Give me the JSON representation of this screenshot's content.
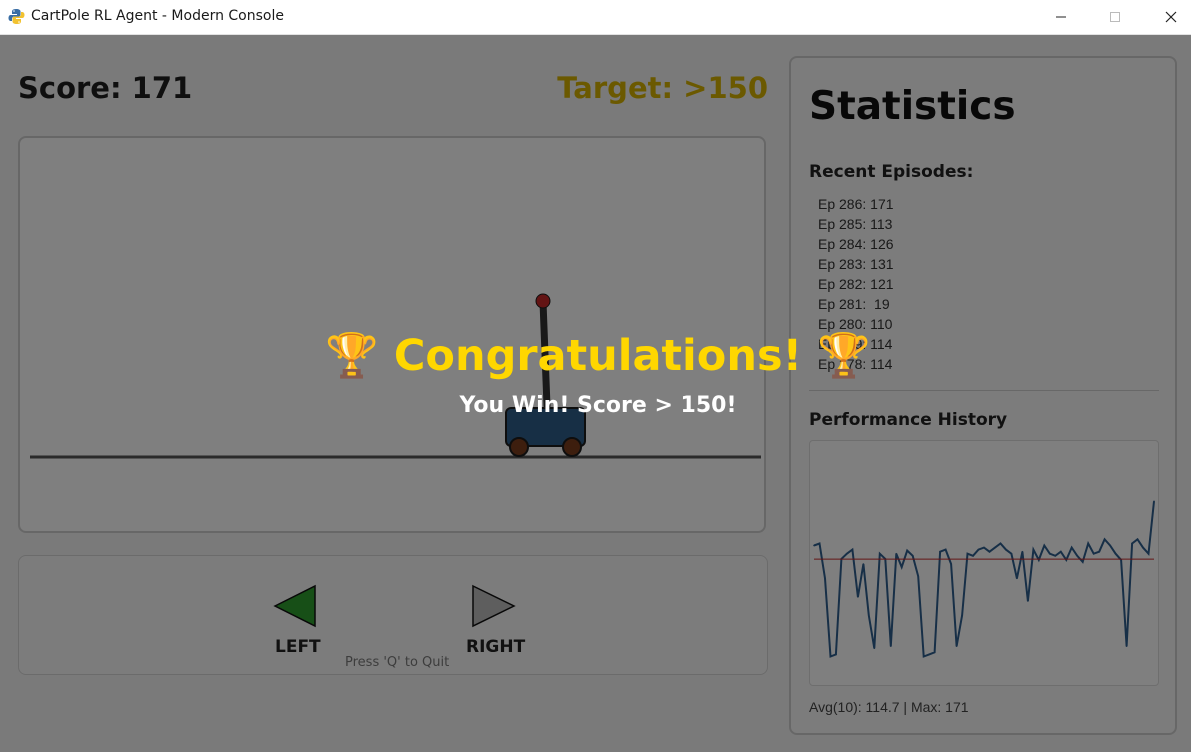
{
  "window": {
    "title": "CartPole RL Agent - Modern Console",
    "icon": "python-snake-icon",
    "controls": [
      "minimize-icon",
      "maximize-icon",
      "close-icon"
    ]
  },
  "header": {
    "score": "Score: 171",
    "target": "Target: >150"
  },
  "game": {
    "cart_color": "#2e5f8a",
    "pole_color": "#333333",
    "pole_tip_color": "#c62828",
    "wheel_color": "#7a3d1c"
  },
  "controls": {
    "left_label": "LEFT",
    "right_label": "RIGHT",
    "quit_hint": "Press 'Q' to Quit",
    "left_color": "#2e9e2e",
    "right_color": "#bdbdbd"
  },
  "stats": {
    "title": "Statistics",
    "recent_title": "Recent Episodes:",
    "episodes": [
      "Ep 286: 171",
      "Ep 285: 113",
      "Ep 284: 126",
      "Ep 283: 131",
      "Ep 282: 121",
      "Ep 281:  19",
      "Ep 280: 110",
      "Ep 279: 114",
      "Ep 278: 114"
    ],
    "performance_title": "Performance History",
    "summary": "Avg(10): 114.7 | Max: 171"
  },
  "chart_data": {
    "type": "line",
    "title": "Performance History",
    "xlabel": "",
    "ylabel": "",
    "ylim": [
      0,
      220
    ],
    "grid": false,
    "series": [
      {
        "values": [
          128,
          130,
          96,
          20,
          22,
          115,
          120,
          124,
          78,
          110,
          60,
          28,
          120,
          115,
          30,
          120,
          107,
          123,
          118,
          98,
          20,
          22,
          24,
          122,
          124,
          110,
          30,
          60,
          120,
          118,
          124,
          126,
          122,
          126,
          130,
          124,
          120,
          96,
          122,
          74,
          124,
          114,
          128,
          120,
          118,
          122,
          114,
          126,
          118,
          112,
          130,
          120,
          122,
          134,
          128,
          120,
          114,
          30,
          130,
          134,
          126,
          120,
          171
        ],
        "color": "#2f5f8f"
      }
    ],
    "reference_line": {
      "value": 114.7,
      "color": "#c62828"
    }
  },
  "overlay": {
    "congrats": "🏆 Congratulations! 🏆",
    "win_text": "You Win! Score > 150!"
  }
}
